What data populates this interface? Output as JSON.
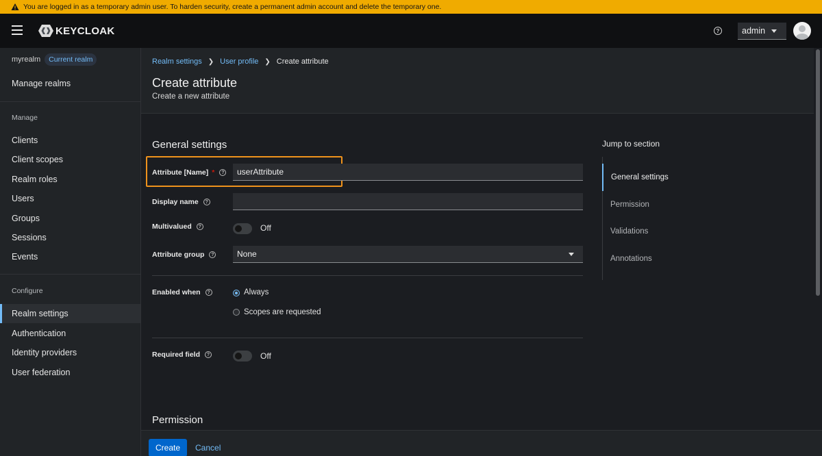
{
  "banner": {
    "text": "You are logged in as a temporary admin user. To harden security, create a permanent admin account and delete the temporary one."
  },
  "masthead": {
    "logo_text": "KEYCLOAK",
    "user": "admin"
  },
  "sidebar": {
    "realm_name": "myrealm",
    "realm_badge": "Current realm",
    "manage_realms": "Manage realms",
    "manage_heading": "Manage",
    "manage_items": [
      "Clients",
      "Client scopes",
      "Realm roles",
      "Users",
      "Groups",
      "Sessions",
      "Events"
    ],
    "configure_heading": "Configure",
    "configure_items": [
      "Realm settings",
      "Authentication",
      "Identity providers",
      "User federation"
    ],
    "active_item": "Realm settings"
  },
  "breadcrumb": [
    "Realm settings",
    "User profile",
    "Create attribute"
  ],
  "page": {
    "title": "Create attribute",
    "subtitle": "Create a new attribute"
  },
  "general": {
    "title": "General settings",
    "attr_name_label": "Attribute [Name]",
    "attr_name_value": "userAttribute",
    "display_name_label": "Display name",
    "display_name_value": "",
    "multivalued_label": "Multivalued",
    "multivalued_state": "Off",
    "attr_group_label": "Attribute group",
    "attr_group_value": "None",
    "enabled_when_label": "Enabled when",
    "enabled_always": "Always",
    "enabled_scopes": "Scopes are requested",
    "required_label": "Required field",
    "required_state": "Off"
  },
  "permission": {
    "title": "Permission"
  },
  "jump": {
    "title": "Jump to section",
    "items": [
      "General settings",
      "Permission",
      "Validations",
      "Annotations"
    ]
  },
  "footer": {
    "create": "Create",
    "cancel": "Cancel"
  },
  "colors": {
    "accent": "#73bcf7",
    "primary_button": "#0066cc",
    "banner": "#f0ab00",
    "highlight": "#f0931c"
  }
}
